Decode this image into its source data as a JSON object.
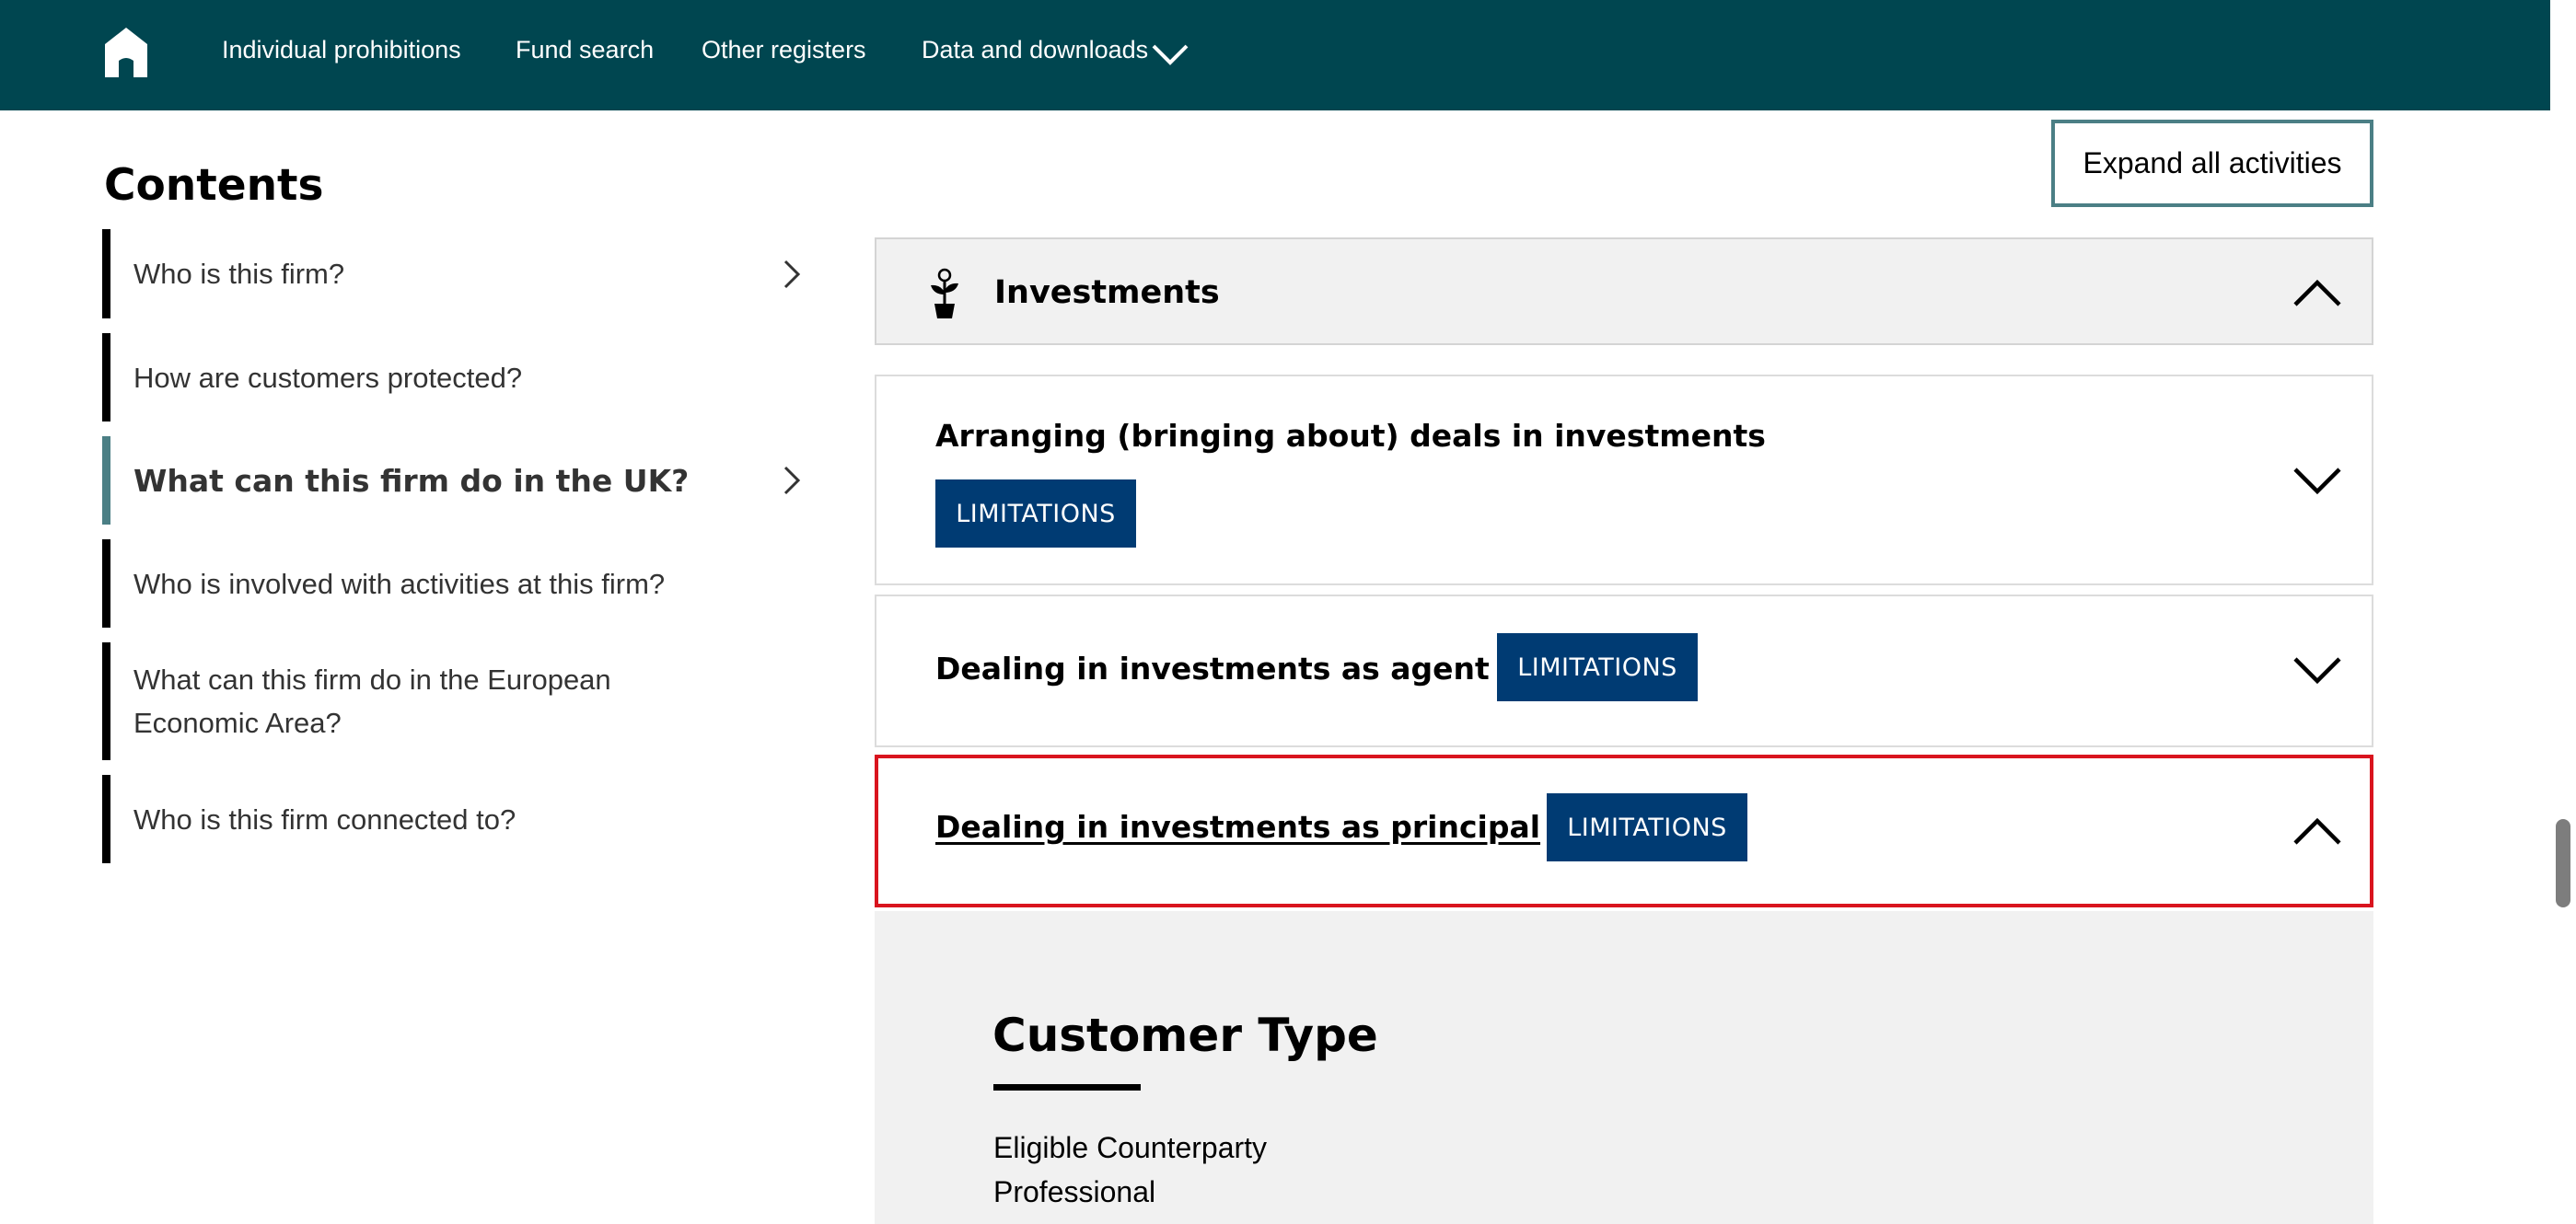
{
  "nav": {
    "items": [
      "Individual prohibitions",
      "Fund search",
      "Other registers",
      "Data and downloads"
    ]
  },
  "sidebar": {
    "title": "Contents",
    "items": [
      {
        "label": "Who is this firm?",
        "active": false,
        "has_arrow": true
      },
      {
        "label": "How are customers protected?",
        "active": false,
        "has_arrow": false
      },
      {
        "label": "What can this firm do in the UK?",
        "active": true,
        "has_arrow": true
      },
      {
        "label": "Who is involved with activities at this firm?",
        "active": false,
        "has_arrow": false
      },
      {
        "label": "What can this firm do in the European Economic Area?",
        "active": false,
        "has_arrow": false
      },
      {
        "label": "Who is this firm connected to?",
        "active": false,
        "has_arrow": false
      }
    ]
  },
  "main": {
    "expand_all_label": "Expand all activities",
    "category": {
      "title": "Investments",
      "icon": "plant-icon",
      "expanded": true
    },
    "activities": [
      {
        "title": "Arranging (bringing about) deals in investments",
        "badge": "LIMITATIONS",
        "expanded": false
      },
      {
        "title": "Dealing in investments as agent",
        "badge": "LIMITATIONS",
        "expanded": false
      },
      {
        "title": "Dealing in investments as principal",
        "badge": "LIMITATIONS",
        "expanded": true
      }
    ],
    "detail": {
      "heading": "Customer Type",
      "items": [
        "Eligible Counterparty",
        "Professional"
      ]
    }
  },
  "colors": {
    "nav_background": "#004650",
    "active_accent": "#4b7f85",
    "badge_background": "#003b73",
    "focus_outline": "#d9141e",
    "panel_grey": "#f1f1f1"
  }
}
